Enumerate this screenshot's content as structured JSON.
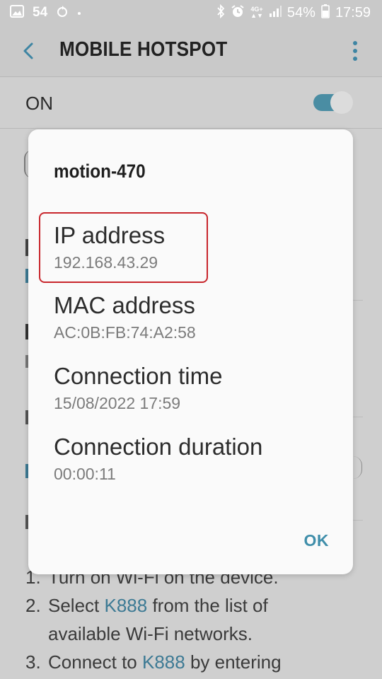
{
  "status_bar": {
    "notification_count": "54",
    "network_type": "4G+",
    "battery_percent": "54%",
    "time": "17:59",
    "icons": [
      "image-icon",
      "notification-54-icon",
      "sync-icon",
      "dot-icon",
      "bluetooth-icon",
      "alarm-icon",
      "signal-icon",
      "battery-icon"
    ]
  },
  "app_bar": {
    "title": "MOBILE HOTSPOT",
    "back_icon": "back-arrow-icon",
    "more_icon": "more-vert-icon"
  },
  "hotspot_switch": {
    "label": "ON",
    "checked": true,
    "accent_color": "#4a8da3"
  },
  "dialog": {
    "device_name": "motion-470",
    "fields": [
      {
        "label": "IP address",
        "value": "192.168.43.29"
      },
      {
        "label": "MAC address",
        "value": "AC:0B:FB:74:A2:58"
      },
      {
        "label": "Connection time",
        "value": "15/08/2022 17:59"
      },
      {
        "label": "Connection duration",
        "value": "00:00:11"
      }
    ],
    "ok_label": "OK",
    "highlight_color": "#c8262c",
    "accent_color": "#3f8eaa"
  },
  "background_instructions": {
    "steps": [
      {
        "num": "1.",
        "text": "Turn on Wi-Fi on the device."
      },
      {
        "num": "2.",
        "pre": "Select ",
        "link": "K888",
        "post": " from the list of"
      },
      {
        "num": "",
        "text": "available Wi-Fi networks."
      },
      {
        "num": "3.",
        "pre": "Connect to ",
        "link": "K888",
        "post": " by entering"
      }
    ],
    "link_color": "#3d7a94"
  }
}
